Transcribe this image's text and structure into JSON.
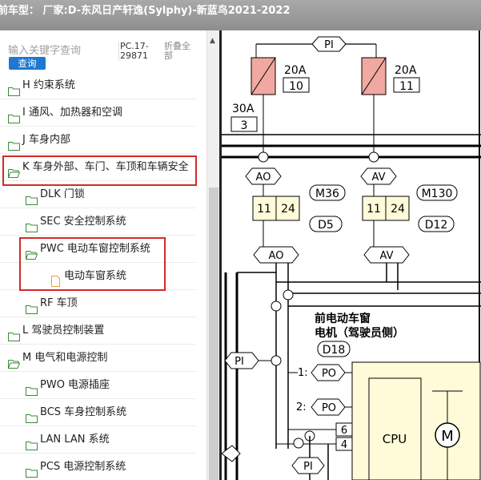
{
  "title": "前车型：  厂家:D-东风日产轩逸(Sylphy)-新蓝鸟2021-2022",
  "search": {
    "placeholder": "输入关键字查询",
    "button": "查询",
    "pc_number": "PC.17-29871",
    "collapse_all": "折叠全部"
  },
  "tree": [
    {
      "label": "H 约束系统",
      "level": 0,
      "icon": "folder-closed-icon"
    },
    {
      "label": "I 通风、加热器和空调",
      "level": 0,
      "icon": "folder-closed-icon"
    },
    {
      "label": "J 车身内部",
      "level": 0,
      "icon": "folder-closed-icon"
    },
    {
      "label": "K 车身外部、车门、车顶和车辆安全",
      "level": 0,
      "icon": "folder-open-icon",
      "highlighted": true
    },
    {
      "label": "DLK 门锁",
      "level": 1,
      "icon": "folder-closed-icon"
    },
    {
      "label": "SEC 安全控制系统",
      "level": 1,
      "icon": "folder-closed-icon"
    },
    {
      "label": "PWC 电动车窗控制系统",
      "level": 1,
      "icon": "folder-open-icon",
      "highlighted": true
    },
    {
      "label": "电动车窗系统",
      "level": 2,
      "icon": "document-icon",
      "highlighted": true
    },
    {
      "label": "RF 车顶",
      "level": 1,
      "icon": "folder-closed-icon"
    },
    {
      "label": "L 驾驶员控制装置",
      "level": 0,
      "icon": "folder-closed-icon"
    },
    {
      "label": "M 电气和电源控制",
      "level": 0,
      "icon": "folder-open-icon"
    },
    {
      "label": "PWO 电源插座",
      "level": 1,
      "icon": "folder-closed-icon"
    },
    {
      "label": "BCS 车身控制系统",
      "level": 1,
      "icon": "folder-closed-icon"
    },
    {
      "label": "LAN LAN 系统",
      "level": 1,
      "icon": "folder-closed-icon"
    },
    {
      "label": "PCS 电源控制系统",
      "level": 1,
      "icon": "folder-closed-icon"
    }
  ],
  "diagram": {
    "connectors": {
      "pi": "PI",
      "ao": "AO",
      "av": "AV",
      "po": "PO"
    },
    "fuses": [
      {
        "amps": "20A",
        "num": "10"
      },
      {
        "amps": "20A",
        "num": "11"
      },
      {
        "amps": "30A",
        "num": "3"
      }
    ],
    "pins": {
      "ao_a": "11",
      "ao_b": "24",
      "av_a": "11",
      "av_b": "24",
      "p6": "6",
      "p4": "4",
      "p1": "1:",
      "p2": "2:"
    },
    "ids": {
      "m36": "M36",
      "d5": "D5",
      "m130": "M130",
      "d12": "D12",
      "d18": "D18"
    },
    "motor_label_1": "前电动车窗",
    "motor_label_2": "电机（驾驶员侧）",
    "cpu": "CPU",
    "motor": "M"
  }
}
